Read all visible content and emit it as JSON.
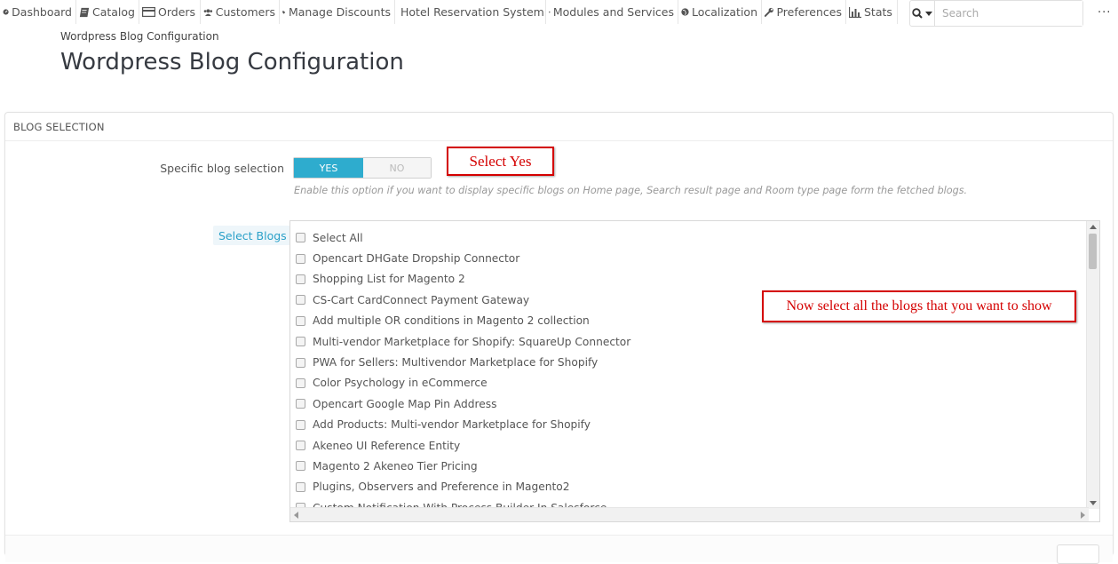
{
  "nav": {
    "items": [
      {
        "label": "Dashboard",
        "icon": "dashboard-icon"
      },
      {
        "label": "Catalog",
        "icon": "book-icon"
      },
      {
        "label": "Orders",
        "icon": "credit-card-icon"
      },
      {
        "label": "Customers",
        "icon": "users-icon"
      },
      {
        "label": "Manage Discounts",
        "icon": "tags-icon"
      },
      {
        "label": "Hotel Reservation System",
        "icon": "bed-icon"
      },
      {
        "label": "Modules and Services",
        "icon": "puzzle-icon"
      },
      {
        "label": "Localization",
        "icon": "globe-icon"
      },
      {
        "label": "Preferences",
        "icon": "wrench-icon"
      },
      {
        "label": "Stats",
        "icon": "bar-chart-icon"
      }
    ],
    "search_placeholder": "Search",
    "more_label": "..."
  },
  "breadcrumb": "Wordpress Blog Configuration",
  "page_title": "Wordpress Blog Configuration",
  "panel": {
    "heading": "BLOG SELECTION",
    "specific_label": "Specific blog selection",
    "switch_yes": "YES",
    "switch_no": "NO",
    "switch_selected": "YES",
    "help_text": "Enable this option if you want to display specific blogs on Home page, Search result page and Room type page form the fetched blogs.",
    "select_blogs_label": "Select Blogs",
    "blogs": [
      "Select All",
      "Opencart DHGate Dropship Connector",
      "Shopping List for Magento 2",
      "CS-Cart CardConnect Payment Gateway",
      "Add multiple OR conditions in Magento 2 collection",
      "Multi-vendor Marketplace for Shopify: SquareUp Connector",
      "PWA for Sellers: Multivendor Marketplace for Shopify",
      "Color Psychology in eCommerce",
      "Opencart Google Map Pin Address",
      "Add Products: Multi-vendor Marketplace for Shopify",
      "Akeneo UI Reference Entity",
      "Magento 2 Akeneo Tier Pricing",
      "Plugins, Observers and Preference in Magento2",
      "Custom Notification With Process Builder In Salesforce"
    ]
  },
  "annotations": {
    "select_yes": "Select Yes",
    "select_all": "Now select all the blogs that you want to show"
  },
  "colors": {
    "accent": "#2eacce",
    "annotation": "#d40000"
  }
}
